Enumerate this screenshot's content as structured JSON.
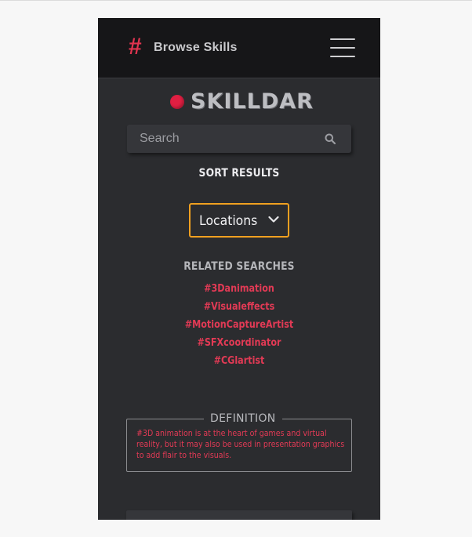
{
  "header": {
    "title": "Browse Skills",
    "hash_symbol": "#"
  },
  "logo": {
    "text": "SKILLDAR",
    "dot_color": "#e01f42"
  },
  "search": {
    "placeholder": "Search",
    "value": ""
  },
  "sort": {
    "title": "SORT RESULTS",
    "selected": "Locations",
    "border_color": "#f0a020"
  },
  "related": {
    "title": "RELATED SEARCHES",
    "items": [
      "#3Danimation",
      "#Visualeffects",
      "#MotionCaptureArtist",
      "#SFXcoordinator",
      "#CGlartist"
    ]
  },
  "definition": {
    "legend": "DEFINITION",
    "text": "#3D animation is at the heart of games and virtual reality, but it may also be used in presentation graphics to add flair to the visuals."
  },
  "colors": {
    "accent": "#e23a55",
    "background": "#2b2c2f",
    "header": "#161618"
  }
}
